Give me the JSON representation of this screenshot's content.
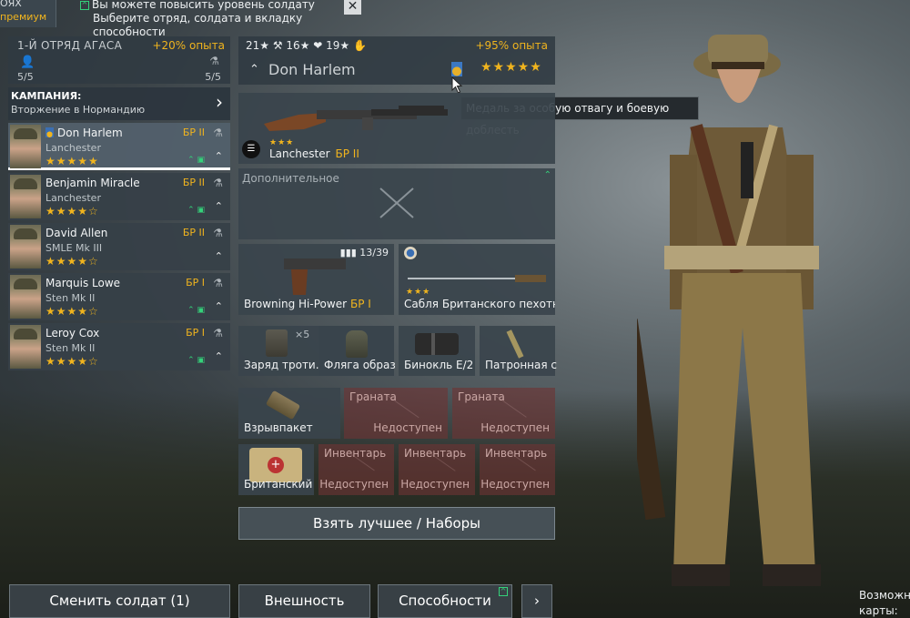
{
  "notice": {
    "left_line1": "ОЯХ",
    "left_line2": "премиум",
    "line1": "Вы можете повысить уровень солдату",
    "line2": "Выберите отряд, солдата и вкладку способности",
    "close": "✕"
  },
  "squad": {
    "name": "1-Й ОТРЯД АГАСА",
    "bonus": "+20% опыта",
    "count_soldiers": "5/5",
    "count_weapons": "5/5"
  },
  "campaign": {
    "title": "КАМПАНИЯ:",
    "subtitle": "Вторжение в Нормандию",
    "arrow": "›"
  },
  "soldiers": [
    {
      "name": "Don Harlem",
      "weapon": "Lanchester",
      "br": "БР II",
      "stars": "★★★★★",
      "upgrade": "»"
    },
    {
      "name": "Benjamin Miracle",
      "weapon": "Lanchester",
      "br": "БР II",
      "stars": "★★★★☆",
      "upgrade": "»"
    },
    {
      "name": "David Allen",
      "weapon": "SMLE Mk III",
      "br": "БР II",
      "stars": "★★★★☆",
      "upgrade": "»"
    },
    {
      "name": "Marquis Lowe",
      "weapon": "Sten Mk II",
      "br": "БР I",
      "stars": "★★★★☆",
      "upgrade": "»"
    },
    {
      "name": "Leroy Cox",
      "weapon": "Sten Mk II",
      "br": "БР I",
      "stars": "★★★★☆",
      "upgrade": "»"
    }
  ],
  "selected": {
    "stats": "21★ ⚒ 16★ ❤ 19★ ✋",
    "bonus": "+95% опыта",
    "name": "Don Harlem",
    "stars": "★★★★★",
    "tooltip": "Медаль за особую отвагу и боевую доблесть"
  },
  "slots": {
    "primary": {
      "name": "Lanchester",
      "br": "БР II",
      "stars": "★★★"
    },
    "secondary_label": "Дополнительное",
    "pistol": {
      "name": "Browning Hi-Power",
      "br": "БР I",
      "ammo": "13/39"
    },
    "melee": {
      "name": "Сабля Британского пехотног",
      "stars": "★★★"
    },
    "items": [
      {
        "name": "Заряд троти.",
        "count": "×5"
      },
      {
        "name": "Фляга образ"
      },
      {
        "name": "Бинокль E/2"
      },
      {
        "name": "Патронная с"
      }
    ],
    "grenade": {
      "name": "Взрывпакет"
    },
    "locked_grenade": [
      {
        "title": "Граната",
        "status": "Недоступен"
      },
      {
        "title": "Граната",
        "status": "Недоступен"
      }
    ],
    "medkit": {
      "name": "Британский"
    },
    "locked_inventory": [
      {
        "title": "Инвентарь",
        "status": "Недоступен"
      },
      {
        "title": "Инвентарь",
        "status": "Недоступен"
      },
      {
        "title": "Инвентарь",
        "status": "Недоступен"
      }
    ]
  },
  "buttons": {
    "best": "Взять лучшее / Наборы",
    "change": "Сменить солдат (1)",
    "appearance": "Внешность",
    "abilities": "Способности",
    "next": "›"
  },
  "corner": {
    "line1": "Возможны",
    "line2": "карты:"
  }
}
